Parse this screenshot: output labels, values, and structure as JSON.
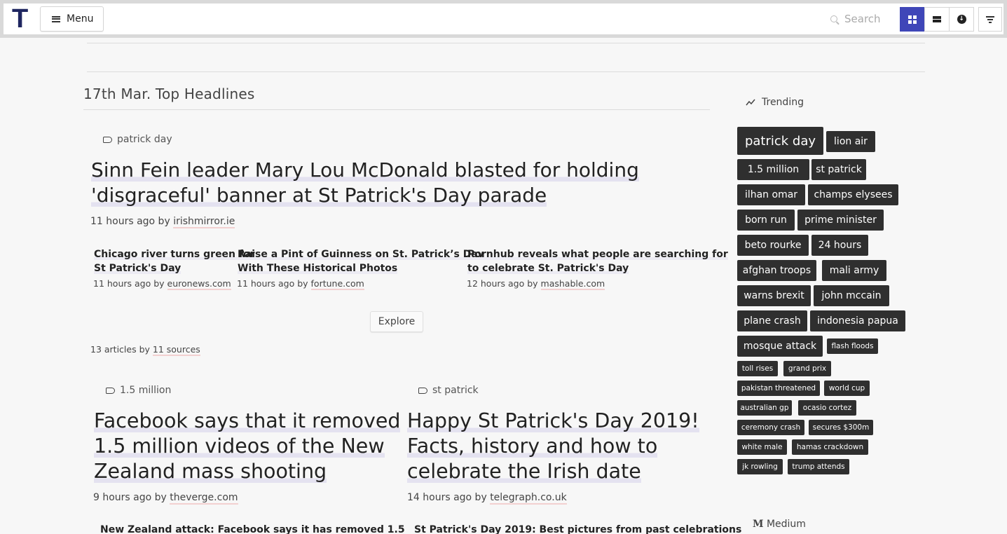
{
  "app": {
    "logo": "T",
    "menu_label": "Menu",
    "search_placeholder": "Search"
  },
  "main": {
    "section_title": "17th Mar. Top Headlines",
    "lead": {
      "tag": "patrick day",
      "headline_line1": "Sinn Fein leader Mary Lou McDonald blasted for holding",
      "headline_line2": "'disgraceful' banner at St Patrick's Day parade",
      "time": "11 hours ago by",
      "source": "irishmirror.ie",
      "related": [
        {
          "line1": "Chicago river turns green for",
          "line2": "St Patrick's Day",
          "time": "11 hours ago by",
          "source": "euronews.com"
        },
        {
          "line1": "Raise a Pint of Guinness on St. Patrick’s Day",
          "line2": "With These Historical Photos",
          "time": "11 hours ago by",
          "source": "fortune.com"
        },
        {
          "line1": "Pornhub reveals what people are searching for",
          "line2": "to celebrate St. Patrick's Day",
          "time": "12 hours ago by",
          "source": "mashable.com"
        }
      ],
      "explore_label": "Explore",
      "count_text": "13 articles by",
      "count_sources": "11 sources"
    },
    "cards": [
      {
        "tag": "1.5 million",
        "lines": [
          "Facebook says that it removed",
          "1.5 million videos of the New",
          "Zealand mass shooting"
        ],
        "time": "9 hours ago by",
        "source": "theverge.com",
        "next": "New Zealand attack: Facebook says it has removed 1.5"
      },
      {
        "tag": "st patrick",
        "lines": [
          "Happy St Patrick's Day 2019!",
          "Facts, history and how to",
          "celebrate the Irish date"
        ],
        "time": "14 hours ago by",
        "source": "telegraph.co.uk",
        "next": "St Patrick's Day 2019: Best pictures from past celebrations"
      }
    ]
  },
  "sidebar": {
    "trending_label": "Trending",
    "chips": [
      "patrick day",
      "lion air",
      "1.5 million",
      "st patrick",
      "ilhan omar",
      "champs elysees",
      "born run",
      "prime minister",
      "beto rourke",
      "24 hours",
      "afghan troops",
      "mali army",
      "warns brexit",
      "john mccain",
      "plane crash",
      "indonesia papua",
      "mosque attack",
      "flash floods",
      "toll rises",
      "grand prix",
      "pakistan threatened",
      "world cup",
      "australian gp",
      "ocasio cortez",
      "ceremony crash",
      "secures $300m",
      "white male",
      "hamas crackdown",
      "jk rowling",
      "trump attends"
    ],
    "medium_label": "Medium",
    "medium_logo": "M"
  },
  "colors": {
    "accent": "#3f46b8",
    "chip_bg": "#2f2f2f",
    "logo": "#1f2660"
  },
  "icons": [
    "search-icon",
    "grid-view-icon",
    "list-view-icon",
    "download-icon",
    "filter-icon",
    "tag-icon",
    "trending-icon",
    "menu-icon"
  ]
}
